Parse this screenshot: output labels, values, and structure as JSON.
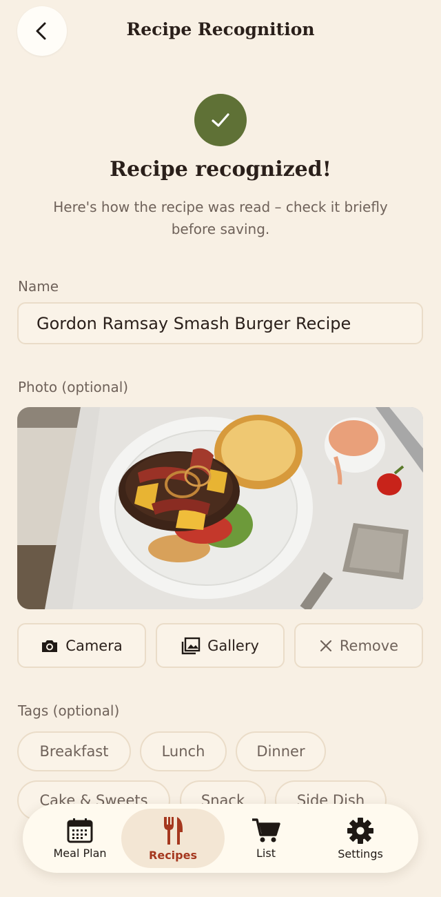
{
  "header": {
    "title": "Recipe Recognition",
    "back_icon": "chevron-left-icon"
  },
  "success": {
    "icon": "checkmark-icon",
    "title": "Recipe recognized!",
    "subtitle": "Here's how the recipe was read – check it briefly before saving."
  },
  "form": {
    "name_label": "Name",
    "name_value": "Gordon Ramsay Smash Burger Recipe",
    "photo_label": "Photo (optional)",
    "photo_buttons": {
      "camera": "Camera",
      "gallery": "Gallery",
      "remove": "Remove"
    },
    "tags_label": "Tags (optional)",
    "tags": [
      "Breakfast",
      "Lunch",
      "Dinner",
      "Cake & Sweets",
      "Snack",
      "Side Dish"
    ]
  },
  "nav": {
    "items": [
      {
        "label": "Meal Plan",
        "icon": "calendar-icon",
        "active": false
      },
      {
        "label": "Recipes",
        "icon": "fork-knife-icon",
        "active": true
      },
      {
        "label": "List",
        "icon": "cart-icon",
        "active": false
      },
      {
        "label": "Settings",
        "icon": "gear-icon",
        "active": false
      }
    ]
  },
  "colors": {
    "background": "#f8f0e4",
    "success_green": "#5f7136",
    "accent_active": "#a5381f"
  }
}
